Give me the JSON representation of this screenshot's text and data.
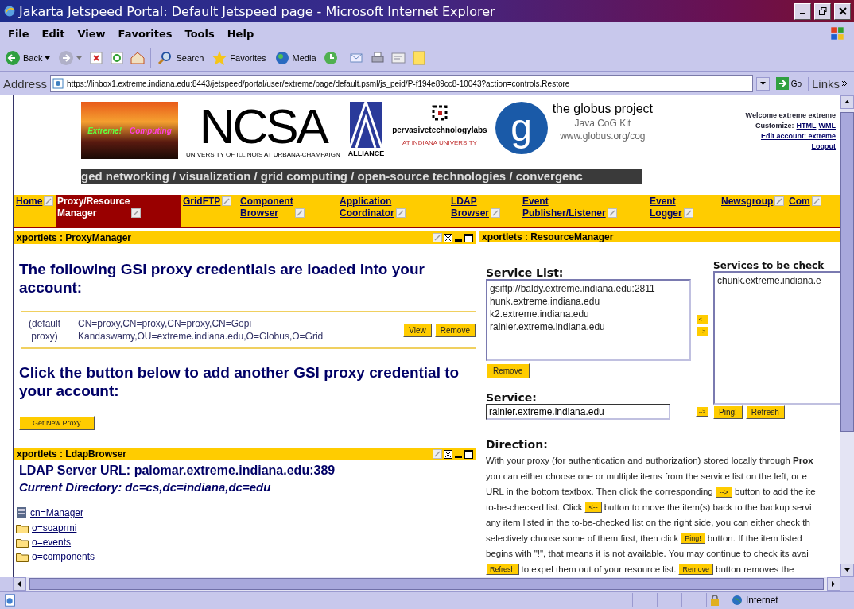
{
  "window": {
    "title": "Jakarta Jetspeed Portal: Default Jetspeed page - Microsoft Internet Explorer"
  },
  "menu": [
    "File",
    "Edit",
    "View",
    "Favorites",
    "Tools",
    "Help"
  ],
  "toolbar": {
    "back": "Back",
    "search": "Search",
    "favorites": "Favorites",
    "media": "Media"
  },
  "address": {
    "label": "Address",
    "url": "https://linbox1.extreme.indiana.edu:8443/jetspeed/portal/user/extreme/page/default.psml/js_peid/P-f194e89cc8-10043?action=controls.Restore",
    "go": "Go",
    "links": "Links"
  },
  "banner": {
    "extreme": "Extreme!",
    "computing": "Computing",
    "ncsa": "NCSA",
    "ncsa_sub": "UNIVERSITY OF ILLINOIS AT URBANA-CHAMPAIGN",
    "alliance": "ALLIANCE",
    "ptl": "pervasivetechnologylabs",
    "ptl_sub": "AT INDIANA UNIVERSITY",
    "globus_mark": "g",
    "globus": "the globus project",
    "cog": "Java CoG Kit",
    "cog_url": "www.globus.org/cog",
    "tagline": "ged networking / visualization / grid computing / open-source technologies / convergenc"
  },
  "user": {
    "welcome": "Welcome extreme extreme",
    "customize": "Customize:",
    "html": "HTML",
    "wml": "WML",
    "edit_account": "Edit account: extreme",
    "logout": "Logout"
  },
  "tabs": [
    {
      "label": "Home",
      "selected": false
    },
    {
      "label": "Proxy/Resource Manager",
      "selected": true
    },
    {
      "label": "GridFTP",
      "selected": false
    },
    {
      "label": "Component Browser",
      "selected": false
    },
    {
      "label": "Application Coordinator",
      "selected": false
    },
    {
      "label": "LDAP Browser",
      "selected": false
    },
    {
      "label": "Event Publisher/Listener",
      "selected": false
    },
    {
      "label": "Event Logger",
      "selected": false
    },
    {
      "label": "Newsgroup",
      "selected": false
    },
    {
      "label": "Com",
      "selected": false
    }
  ],
  "proxy_manager": {
    "title": "xportlets : ProxyManager",
    "heading": "The following GSI proxy credentials are loaded into your account:",
    "credentials": [
      {
        "name": "(default proxy)",
        "dn": "CN=proxy,CN=proxy,CN=proxy,CN=Gopi Kandaswamy,OU=extreme.indiana.edu,O=Globus,O=Grid",
        "buttons": [
          "View",
          "Remove"
        ]
      }
    ],
    "add_heading": "Click the button below to add another GSI proxy credential to your account:",
    "button": "Get New Proxy"
  },
  "ldap_browser": {
    "title": "xportlets : LdapBrowser",
    "server_url": "LDAP Server URL: palomar.extreme.indiana.edu:389",
    "directory": "Current Directory: dc=cs,dc=indiana,dc=edu",
    "entries": [
      {
        "kind": "server",
        "label": "cn=Manager"
      },
      {
        "kind": "folder",
        "label": "o=soaprmi"
      },
      {
        "kind": "folder",
        "label": "o=events"
      },
      {
        "kind": "folder",
        "label": "o=components"
      }
    ]
  },
  "resource_manager": {
    "title": "xportlets : ResourceManager",
    "service_list_label": "Service List:",
    "services": [
      {
        "label": "gsiftp://baldy.extreme.indiana.edu:2811",
        "selected": false
      },
      {
        "label": "hunk.extreme.indiana.edu",
        "selected": false
      },
      {
        "label": "k2.extreme.indiana.edu",
        "selected": false
      },
      {
        "label": "rainier.extreme.indiana.edu",
        "selected": false
      }
    ],
    "move_left": "<--",
    "move_right": "-->",
    "remove": "Remove",
    "service_label": "Service:",
    "service_value": "rainier.extreme.indiana.edu",
    "add": "-->",
    "check_label": "Services to be check",
    "checked": [
      {
        "label": "chunk.extreme.indiana.e",
        "selected": false
      }
    ],
    "ping": "Ping!",
    "refresh": "Refresh",
    "direction_title": "Direction:",
    "direction_lines": [
      [
        {
          "kind": "text",
          "text": "With your proxy (for authentication and authorization) stored locally through **Prox**"
        }
      ],
      [
        {
          "kind": "text",
          "text": "you can either choose one or multiple items from the service list on the left, or e"
        }
      ],
      [
        {
          "kind": "text",
          "text": "URL in the bottom textbox. Then click the corresponding"
        },
        {
          "kind": "button",
          "text": "-->"
        },
        {
          "kind": "text",
          "text": "button to add the ite"
        }
      ],
      [
        {
          "kind": "text",
          "text": "to-be-checked list. Click"
        },
        {
          "kind": "button",
          "text": "<--"
        },
        {
          "kind": "text",
          "text": "button to move the item(s) back to the backup servi"
        }
      ],
      [
        {
          "kind": "text",
          "text": "any item listed in the to-be-checked list on the right side, you can either check th"
        }
      ],
      [
        {
          "kind": "text",
          "text": "selectively choose some of them first, then click"
        },
        {
          "kind": "button",
          "text": "Ping!"
        },
        {
          "kind": "text",
          "text": "button. If the item listed"
        }
      ],
      [
        {
          "kind": "text",
          "text": "begins with \"!\", that means it is not available. You may continue to check its avai"
        }
      ],
      [
        {
          "kind": "button",
          "text": "Refresh"
        },
        {
          "kind": "text",
          "text": "to expel them out of your resource list."
        },
        {
          "kind": "button",
          "text": "Remove"
        },
        {
          "kind": "text",
          "text": "button removes the"
        }
      ]
    ]
  },
  "status_bar": {
    "zone": "Internet"
  }
}
